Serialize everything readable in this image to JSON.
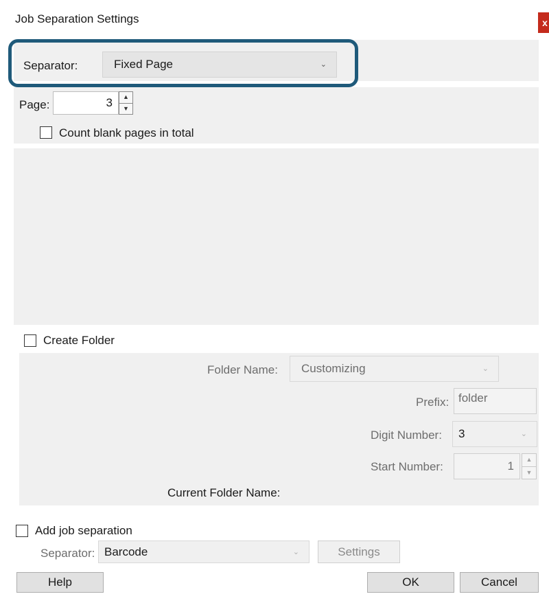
{
  "window": {
    "title": "Job Separation Settings",
    "close_label": "x"
  },
  "separator_section": {
    "label": "Separator:",
    "value": "Fixed Page"
  },
  "page_section": {
    "page_label": "Page:",
    "page_value": "3",
    "count_blank_label": "Count blank pages in total",
    "count_blank_checked": false
  },
  "create_folder": {
    "label": "Create Folder",
    "checked": false,
    "folder_name_label": "Folder Name:",
    "folder_name_value": "Customizing",
    "prefix_label": "Prefix:",
    "prefix_value": "folder",
    "digit_number_label": "Digit Number:",
    "digit_number_value": "3",
    "start_number_label": "Start Number:",
    "start_number_value": "1",
    "current_folder_name_label": "Current Folder Name:"
  },
  "job_separation": {
    "label": "Add job separation",
    "checked": false,
    "separator_label": "Separator:",
    "separator_value": "Barcode",
    "settings_button": "Settings"
  },
  "footer": {
    "help_button": "Help",
    "ok_button": "OK",
    "cancel_button": "Cancel"
  },
  "colors": {
    "highlight_border": "#1f5a7a",
    "close_button": "#c42b1c",
    "panel_background": "#f0f0f0"
  }
}
